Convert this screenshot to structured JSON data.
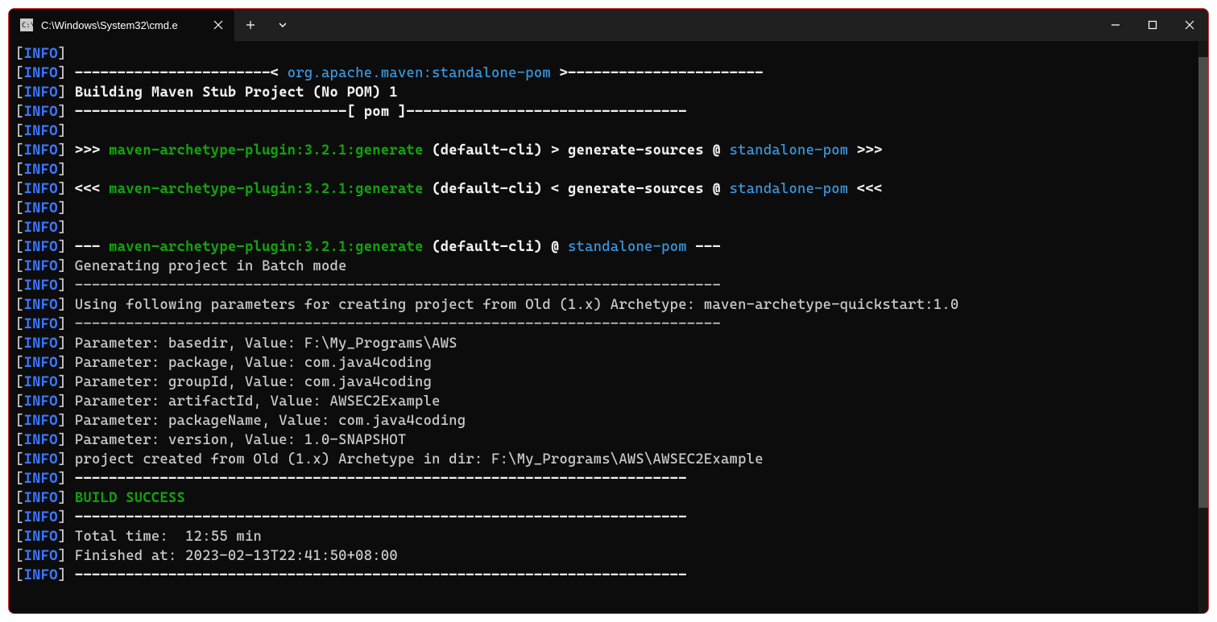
{
  "tab": {
    "title": "C:\\Windows\\System32\\cmd.e"
  },
  "lines": [
    {
      "prefix": "INFO",
      "segments": []
    },
    {
      "prefix": "INFO",
      "segments": [
        {
          "text": " ",
          "cls": ""
        },
        {
          "text": "-----------------------< ",
          "cls": "bold-white"
        },
        {
          "text": "org.apache.maven:standalone-pom",
          "cls": "cyan-tag"
        },
        {
          "text": " >-----------------------",
          "cls": "bold-white"
        }
      ]
    },
    {
      "prefix": "INFO",
      "segments": [
        {
          "text": " ",
          "cls": ""
        },
        {
          "text": "Building Maven Stub Project (No POM) 1",
          "cls": "bold-white"
        }
      ]
    },
    {
      "prefix": "INFO",
      "segments": [
        {
          "text": " ",
          "cls": ""
        },
        {
          "text": "--------------------------------[ pom ]---------------------------------",
          "cls": "bold-white"
        }
      ]
    },
    {
      "prefix": "INFO",
      "segments": []
    },
    {
      "prefix": "INFO",
      "segments": [
        {
          "text": " ",
          "cls": ""
        },
        {
          "text": ">>> ",
          "cls": "bold-white"
        },
        {
          "text": "maven-archetype-plugin:3.2.1:generate",
          "cls": "green-tag"
        },
        {
          "text": " ",
          "cls": ""
        },
        {
          "text": "(default-cli)",
          "cls": "bold-white"
        },
        {
          "text": " > ",
          "cls": "bold-white"
        },
        {
          "text": "generate-sources",
          "cls": "bold-white"
        },
        {
          "text": " @ ",
          "cls": "bold-white"
        },
        {
          "text": "standalone-pom",
          "cls": "cyan-tag"
        },
        {
          "text": " >>>",
          "cls": "bold-white"
        }
      ]
    },
    {
      "prefix": "INFO",
      "segments": []
    },
    {
      "prefix": "INFO",
      "segments": [
        {
          "text": " ",
          "cls": ""
        },
        {
          "text": "<<< ",
          "cls": "bold-white"
        },
        {
          "text": "maven-archetype-plugin:3.2.1:generate",
          "cls": "green-tag"
        },
        {
          "text": " ",
          "cls": ""
        },
        {
          "text": "(default-cli)",
          "cls": "bold-white"
        },
        {
          "text": " < ",
          "cls": "bold-white"
        },
        {
          "text": "generate-sources",
          "cls": "bold-white"
        },
        {
          "text": " @ ",
          "cls": "bold-white"
        },
        {
          "text": "standalone-pom",
          "cls": "cyan-tag"
        },
        {
          "text": " <<<",
          "cls": "bold-white"
        }
      ]
    },
    {
      "prefix": "INFO",
      "segments": []
    },
    {
      "prefix": "INFO",
      "segments": []
    },
    {
      "prefix": "INFO",
      "segments": [
        {
          "text": " ",
          "cls": ""
        },
        {
          "text": "--- ",
          "cls": "bold-white"
        },
        {
          "text": "maven-archetype-plugin:3.2.1:generate",
          "cls": "green-tag"
        },
        {
          "text": " ",
          "cls": ""
        },
        {
          "text": "(default-cli)",
          "cls": "bold-white"
        },
        {
          "text": " @ ",
          "cls": "bold-white"
        },
        {
          "text": "standalone-pom",
          "cls": "cyan-tag"
        },
        {
          "text": " ---",
          "cls": "bold-white"
        }
      ]
    },
    {
      "prefix": "INFO",
      "segments": [
        {
          "text": " Generating project in Batch mode",
          "cls": ""
        }
      ]
    },
    {
      "prefix": "INFO",
      "segments": [
        {
          "text": " ----------------------------------------------------------------------------",
          "cls": ""
        }
      ]
    },
    {
      "prefix": "INFO",
      "segments": [
        {
          "text": " Using following parameters for creating project from Old (1.x) Archetype: maven-archetype-quickstart:1.0",
          "cls": ""
        }
      ]
    },
    {
      "prefix": "INFO",
      "segments": [
        {
          "text": " ----------------------------------------------------------------------------",
          "cls": ""
        }
      ]
    },
    {
      "prefix": "INFO",
      "segments": [
        {
          "text": " Parameter: basedir, Value: F:\\My_Programs\\AWS",
          "cls": ""
        }
      ]
    },
    {
      "prefix": "INFO",
      "segments": [
        {
          "text": " Parameter: package, Value: com.java4coding",
          "cls": ""
        }
      ]
    },
    {
      "prefix": "INFO",
      "segments": [
        {
          "text": " Parameter: groupId, Value: com.java4coding",
          "cls": ""
        }
      ]
    },
    {
      "prefix": "INFO",
      "segments": [
        {
          "text": " Parameter: artifactId, Value: AWSEC2Example",
          "cls": ""
        }
      ]
    },
    {
      "prefix": "INFO",
      "segments": [
        {
          "text": " Parameter: packageName, Value: com.java4coding",
          "cls": ""
        }
      ]
    },
    {
      "prefix": "INFO",
      "segments": [
        {
          "text": " Parameter: version, Value: 1.0-SNAPSHOT",
          "cls": ""
        }
      ]
    },
    {
      "prefix": "INFO",
      "segments": [
        {
          "text": " project created from Old (1.x) Archetype in dir: F:\\My_Programs\\AWS\\AWSEC2Example",
          "cls": ""
        }
      ]
    },
    {
      "prefix": "INFO",
      "segments": [
        {
          "text": " ",
          "cls": ""
        },
        {
          "text": "------------------------------------------------------------------------",
          "cls": "bold-white"
        }
      ]
    },
    {
      "prefix": "INFO",
      "segments": [
        {
          "text": " ",
          "cls": ""
        },
        {
          "text": "BUILD SUCCESS",
          "cls": "green-tag"
        }
      ]
    },
    {
      "prefix": "INFO",
      "segments": [
        {
          "text": " ",
          "cls": ""
        },
        {
          "text": "------------------------------------------------------------------------",
          "cls": "bold-white"
        }
      ]
    },
    {
      "prefix": "INFO",
      "segments": [
        {
          "text": " Total time:  12:55 min",
          "cls": ""
        }
      ]
    },
    {
      "prefix": "INFO",
      "segments": [
        {
          "text": " Finished at: 2023-02-13T22:41:50+08:00",
          "cls": ""
        }
      ]
    },
    {
      "prefix": "INFO",
      "segments": [
        {
          "text": " ",
          "cls": ""
        },
        {
          "text": "------------------------------------------------------------------------",
          "cls": "bold-white"
        }
      ]
    }
  ]
}
